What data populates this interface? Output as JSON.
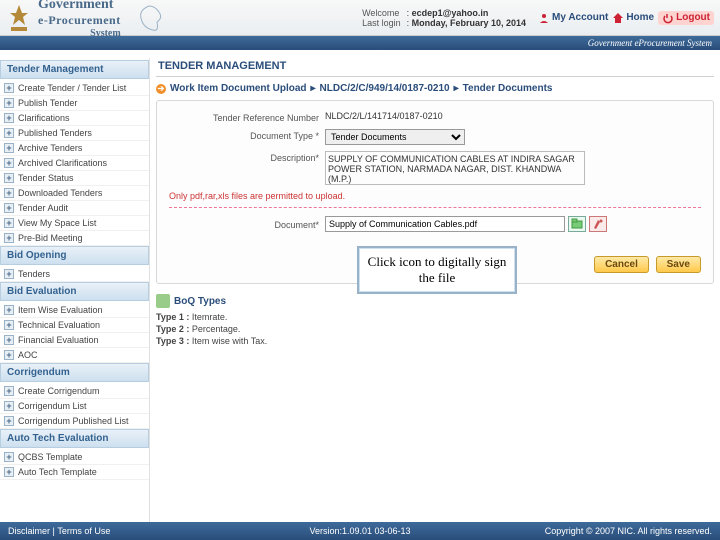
{
  "brand": {
    "line1": "Government",
    "line2": "e-Procurement",
    "line3": "System"
  },
  "welcome": {
    "welcome_lbl": "Welcome",
    "welcome_val": "ecdep1@yahoo.in",
    "lastlogin_lbl": "Last login",
    "lastlogin_val": "Monday, February 10, 2014"
  },
  "topnav": {
    "account": "My Account",
    "home": "Home",
    "logout": "Logout"
  },
  "subbar": "Government eProcurement System",
  "section_title": "TENDER MANAGEMENT",
  "breadcrumb": {
    "item1": "Work Item Document Upload",
    "item2": "NLDC/2/C/949/14/0187-0210",
    "item3": "Tender Documents"
  },
  "sidebar_groups": [
    {
      "header": "Tender Management",
      "items": [
        "Create Tender / Tender List",
        "Publish Tender",
        "Clarifications",
        "Published Tenders",
        "Archive Tenders",
        "Archived Clarifications",
        "Tender Status",
        "Downloaded Tenders",
        "Tender Audit",
        "View My Space List",
        "Pre-Bid Meeting"
      ]
    },
    {
      "header": "Bid Opening",
      "items": [
        "Tenders"
      ]
    },
    {
      "header": "Bid Evaluation",
      "items": [
        "Item Wise Evaluation",
        "Technical Evaluation",
        "Financial Evaluation",
        "AOC"
      ]
    },
    {
      "header": "Corrigendum",
      "items": [
        "Create Corrigendum",
        "Corrigendum List",
        "Corrigendum Published List"
      ]
    },
    {
      "header": "Auto Tech Evaluation",
      "items": [
        "QCBS Template",
        "Auto Tech Template"
      ]
    }
  ],
  "panel": {
    "ref_lbl": "Tender Reference Number",
    "ref_val": "NLDC/2/L/141714/0187-0210",
    "doctype_lbl": "Document Type *",
    "doctype_val": "Tender Documents",
    "desc_lbl": "Description*",
    "desc_val": "SUPPLY OF COMMUNICATION CABLES AT INDIRA SAGAR POWER STATION, NARMADA NAGAR, DIST. KHANDWA (M.P.)",
    "note": "Only pdf,rar,xls files are permitted to upload.",
    "doc_lbl": "Document*",
    "doc_val": "Supply of Communication Cables.pdf",
    "callout": "Click icon to digitally sign the file",
    "cancel_btn": "Cancel",
    "save_btn": "Save"
  },
  "boq": {
    "header": "BoQ Types",
    "t1_lbl": "Type 1 :",
    "t1_val": "Itemrate.",
    "t2_lbl": "Type 2 :",
    "t2_val": "Percentage.",
    "t3_lbl": "Type 3 :",
    "t3_val": "Item wise with Tax."
  },
  "footer": {
    "left1": "Disclaimer",
    "left2": "Terms of Use",
    "version": "Version:1.09.01 03-06-13",
    "copyright": "Copyright © 2007 NIC. All rights reserved."
  }
}
